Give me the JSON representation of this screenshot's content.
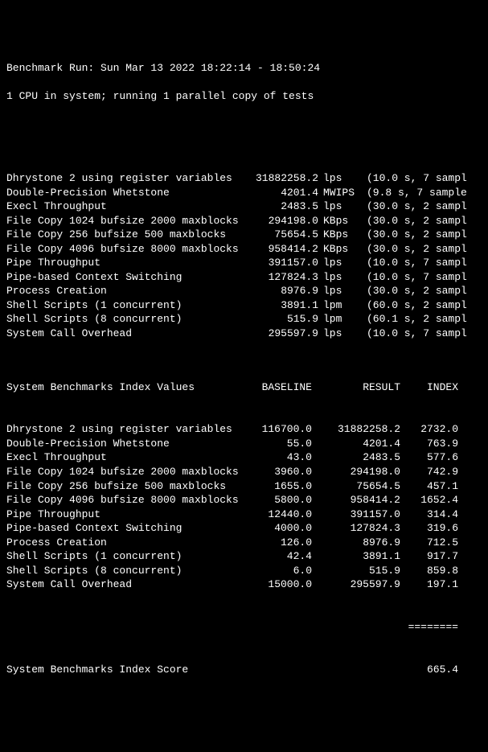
{
  "header": {
    "run_line": "Benchmark Run: Sun Mar 13 2022 18:22:14 - 18:50:24",
    "cpu_line": "1 CPU in system; running 1 parallel copy of tests"
  },
  "section1": [
    {
      "name": "Dhrystone 2 using register variables",
      "value": "31882258.2",
      "unit": "lps",
      "time": "(10.0 s, 7 sampl"
    },
    {
      "name": "Double-Precision Whetstone",
      "value": "4201.4",
      "unit": "MWIPS",
      "time": "(9.8 s, 7 sample"
    },
    {
      "name": "Execl Throughput",
      "value": "2483.5",
      "unit": "lps",
      "time": "(30.0 s, 2 sampl"
    },
    {
      "name": "File Copy 1024 bufsize 2000 maxblocks",
      "value": "294198.0",
      "unit": "KBps",
      "time": "(30.0 s, 2 sampl"
    },
    {
      "name": "File Copy 256 bufsize 500 maxblocks",
      "value": "75654.5",
      "unit": "KBps",
      "time": "(30.0 s, 2 sampl"
    },
    {
      "name": "File Copy 4096 bufsize 8000 maxblocks",
      "value": "958414.2",
      "unit": "KBps",
      "time": "(30.0 s, 2 sampl"
    },
    {
      "name": "Pipe Throughput",
      "value": "391157.0",
      "unit": "lps",
      "time": "(10.0 s, 7 sampl"
    },
    {
      "name": "Pipe-based Context Switching",
      "value": "127824.3",
      "unit": "lps",
      "time": "(10.0 s, 7 sampl"
    },
    {
      "name": "Process Creation",
      "value": "8976.9",
      "unit": "lps",
      "time": "(30.0 s, 2 sampl"
    },
    {
      "name": "Shell Scripts (1 concurrent)",
      "value": "3891.1",
      "unit": "lpm",
      "time": "(60.0 s, 2 sampl"
    },
    {
      "name": "Shell Scripts (8 concurrent)",
      "value": "515.9",
      "unit": "lpm",
      "time": "(60.1 s, 2 sampl"
    },
    {
      "name": "System Call Overhead",
      "value": "295597.9",
      "unit": "lps",
      "time": "(10.0 s, 7 sampl"
    }
  ],
  "section2_header": {
    "title": "System Benchmarks Index Values",
    "col_a": "BASELINE",
    "col_b": "RESULT",
    "col_c": "INDEX"
  },
  "section2": [
    {
      "name": "Dhrystone 2 using register variables",
      "baseline": "116700.0",
      "result": "31882258.2",
      "index": "2732.0"
    },
    {
      "name": "Double-Precision Whetstone",
      "baseline": "55.0",
      "result": "4201.4",
      "index": "763.9"
    },
    {
      "name": "Execl Throughput",
      "baseline": "43.0",
      "result": "2483.5",
      "index": "577.6"
    },
    {
      "name": "File Copy 1024 bufsize 2000 maxblocks",
      "baseline": "3960.0",
      "result": "294198.0",
      "index": "742.9"
    },
    {
      "name": "File Copy 256 bufsize 500 maxblocks",
      "baseline": "1655.0",
      "result": "75654.5",
      "index": "457.1"
    },
    {
      "name": "File Copy 4096 bufsize 8000 maxblocks",
      "baseline": "5800.0",
      "result": "958414.2",
      "index": "1652.4"
    },
    {
      "name": "Pipe Throughput",
      "baseline": "12440.0",
      "result": "391157.0",
      "index": "314.4"
    },
    {
      "name": "Pipe-based Context Switching",
      "baseline": "4000.0",
      "result": "127824.3",
      "index": "319.6"
    },
    {
      "name": "Process Creation",
      "baseline": "126.0",
      "result": "8976.9",
      "index": "712.5"
    },
    {
      "name": "Shell Scripts (1 concurrent)",
      "baseline": "42.4",
      "result": "3891.1",
      "index": "917.7"
    },
    {
      "name": "Shell Scripts (8 concurrent)",
      "baseline": "6.0",
      "result": "515.9",
      "index": "859.8"
    },
    {
      "name": "System Call Overhead",
      "baseline": "15000.0",
      "result": "295597.9",
      "index": "197.1"
    }
  ],
  "separator": "========",
  "footer": {
    "label": "System Benchmarks Index Score",
    "value": "665.4"
  }
}
